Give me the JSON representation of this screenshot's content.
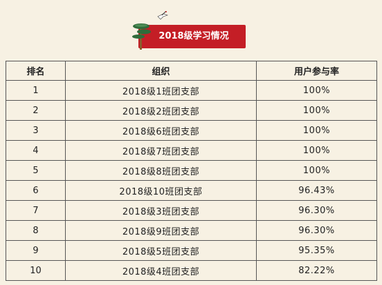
{
  "banner": {
    "title": "2018级学习情况",
    "color": "#c41e26",
    "decoration_icon": "pine-tree-crane-icon"
  },
  "table": {
    "headers": [
      "排名",
      "组织",
      "用户参与率"
    ],
    "rows": [
      {
        "rank": "1",
        "org": "2018级1班团支部",
        "rate": "100%"
      },
      {
        "rank": "2",
        "org": "2018级2班团支部",
        "rate": "100%"
      },
      {
        "rank": "3",
        "org": "2018级6班团支部",
        "rate": "100%"
      },
      {
        "rank": "4",
        "org": "2018级7班团支部",
        "rate": "100%"
      },
      {
        "rank": "5",
        "org": "2018级8班团支部",
        "rate": "100%"
      },
      {
        "rank": "6",
        "org": "2018级10班团支部",
        "rate": "96.43%"
      },
      {
        "rank": "7",
        "org": "2018级3班团支部",
        "rate": "96.30%"
      },
      {
        "rank": "8",
        "org": "2018级9班团支部",
        "rate": "96.30%"
      },
      {
        "rank": "9",
        "org": "2018级5班团支部",
        "rate": "95.35%"
      },
      {
        "rank": "10",
        "org": "2018级4班团支部",
        "rate": "82.22%"
      }
    ]
  }
}
